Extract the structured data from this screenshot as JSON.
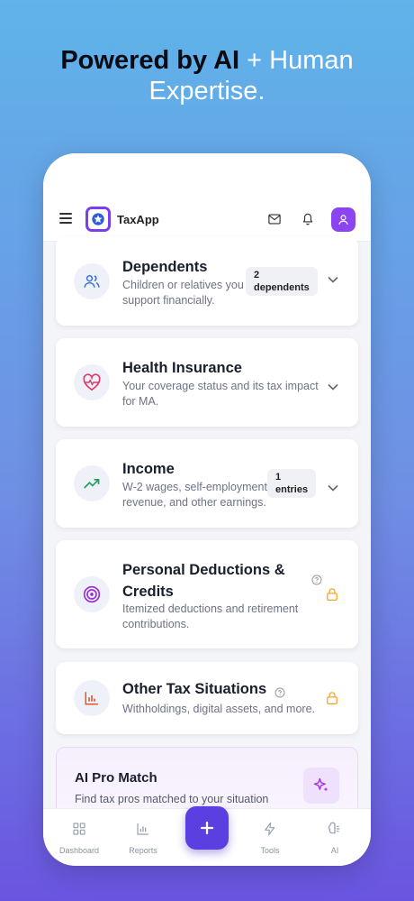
{
  "headline": {
    "bold": "Powered by AI",
    "rest": " + Human",
    "line2": "Expertise."
  },
  "app": {
    "name": "TaxApp"
  },
  "icons": {
    "menu": "hamburger-menu-icon",
    "logo": "star-badge-icon",
    "mail": "mail-icon",
    "bell": "bell-icon",
    "avatar": "user-icon",
    "chevron": "chevron-down-icon",
    "lock": "lock-icon",
    "help": "help-circle-icon"
  },
  "colors": {
    "accent": "#7b3df0",
    "fab": "#5c3fe0",
    "lock": "#f5a524"
  },
  "sections": [
    {
      "title": "Dependents",
      "desc": "Children or relatives you support financially.",
      "badge_count": "2",
      "badge_unit": "dependents",
      "icon": "users-icon"
    },
    {
      "title": "Health Insurance",
      "desc": "Your coverage status and its tax impact for MA.",
      "icon": "heart-pulse-icon"
    },
    {
      "title": "Income",
      "desc": "W-2 wages, self-employment revenue, and other earnings.",
      "badge_count": "1",
      "badge_unit": "entries",
      "icon": "trending-up-icon"
    },
    {
      "title": "Personal Deductions & Credits",
      "title_l1": "Personal Deductions &",
      "title_l2": "Credits",
      "desc": "Itemized deductions and retirement contributions.",
      "icon": "target-icon",
      "locked": true
    },
    {
      "title": "Other Tax Situations",
      "desc": "Withholdings, digital assets, and more.",
      "icon": "bar-chart-icon",
      "locked": true
    }
  ],
  "promo": {
    "title": "AI Pro Match",
    "desc": "Find tax pros matched to your situation",
    "icon": "sparkles-icon"
  },
  "tabs": [
    {
      "label": "Dashboard",
      "icon": "grid-icon"
    },
    {
      "label": "Reports",
      "icon": "bar-chart-icon"
    },
    {
      "label": "",
      "icon": "plus-icon"
    },
    {
      "label": "Tools",
      "icon": "lightning-icon"
    },
    {
      "label": "AI",
      "icon": "brain-icon"
    }
  ]
}
